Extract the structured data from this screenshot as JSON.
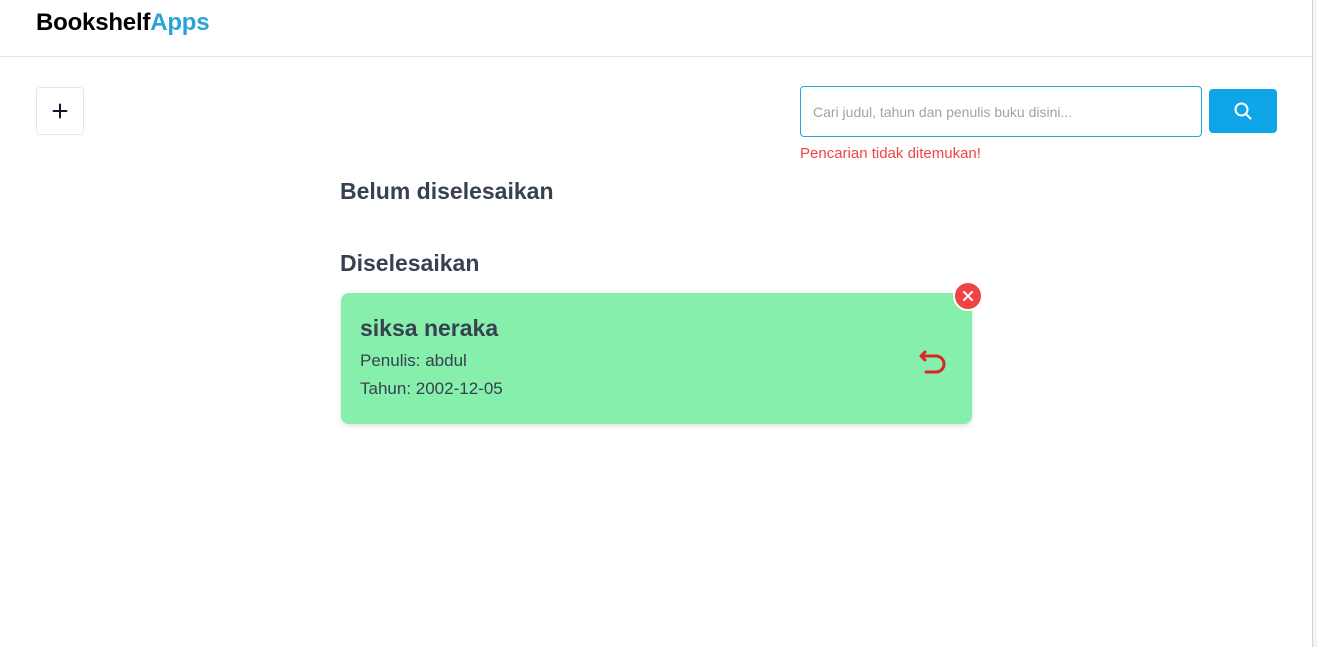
{
  "app": {
    "brand_main": "Bookshelf",
    "brand_accent": "Apps",
    "accent_color": "#2aa3d6"
  },
  "toolbar": {
    "add_icon": "plus-icon",
    "search": {
      "placeholder": "Cari judul, tahun dan penulis buku disini...",
      "value": "",
      "button_icon": "search-icon",
      "button_color": "#0ea5e9"
    },
    "error_message": "Pencarian tidak ditemukan!",
    "error_color": "#ef4444"
  },
  "sections": {
    "unfinished": {
      "title": "Belum diselesaikan",
      "books": []
    },
    "finished": {
      "title": "Diselesaikan",
      "books": [
        {
          "title": "siksa neraka",
          "author_line": "Penulis: abdul",
          "year_line": "Tahun: 2002-12-05",
          "card_color": "#86efac",
          "undo_icon": "undo-icon",
          "delete_icon": "close-icon"
        }
      ]
    }
  }
}
